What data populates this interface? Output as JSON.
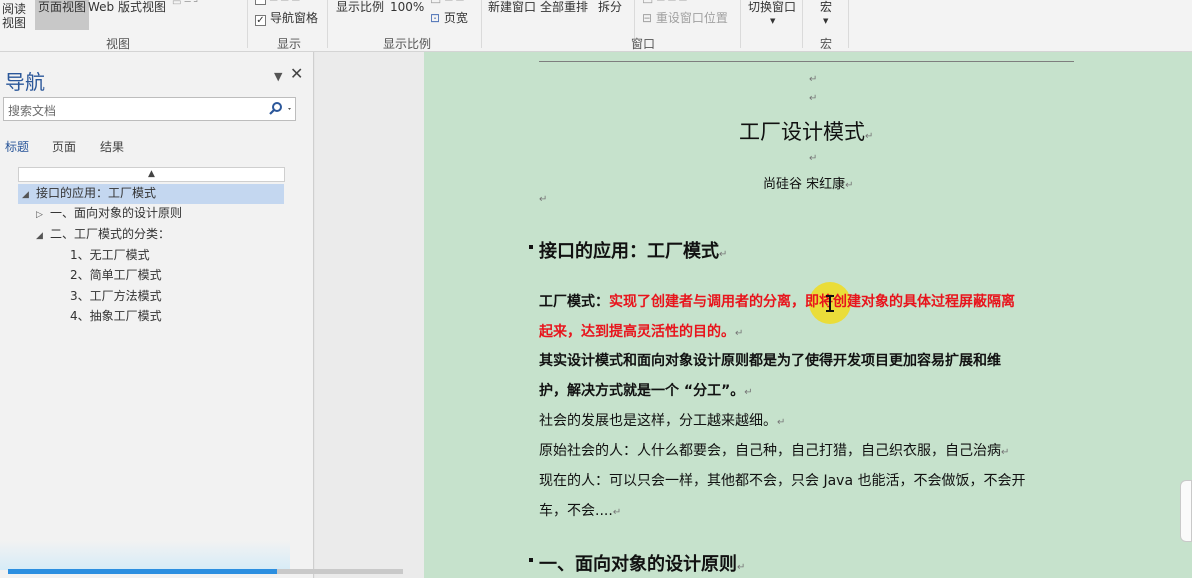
{
  "ribbon": {
    "view_group": {
      "read_view": "阅读\n视图",
      "page_view": "页面视图",
      "web_view": "Web 版式视图",
      "label": "视图"
    },
    "show_group": {
      "nav_pane": "导航窗格",
      "label": "显示"
    },
    "zoom_group": {
      "zoom": "显示比例",
      "hundred": "100%",
      "page_width": "页宽",
      "label": "显示比例"
    },
    "window_group": {
      "new_window": "新建窗口",
      "arrange_all": "全部重排",
      "split": "拆分",
      "reset_window": "重设窗口位置",
      "switch_window": "切换窗口",
      "label": "窗口"
    },
    "macro_group": {
      "macro": "宏",
      "label": "宏"
    }
  },
  "nav": {
    "title": "导航",
    "search_placeholder": "搜索文档",
    "tabs": [
      "标题",
      "页面",
      "结果"
    ],
    "headings": [
      {
        "text": "接口的应用：工厂模式",
        "level": 1,
        "expand": "◢",
        "selected": true
      },
      {
        "text": "一、面向对象的设计原则",
        "level": 2,
        "expand": "▷",
        "selected": false
      },
      {
        "text": "二、工厂模式的分类：",
        "level": 2,
        "expand": "◢",
        "selected": false
      },
      {
        "text": "1、无工厂模式",
        "level": 3,
        "expand": "",
        "selected": false
      },
      {
        "text": "2、简单工厂模式",
        "level": 3,
        "expand": "",
        "selected": false
      },
      {
        "text": "3、工厂方法模式",
        "level": 3,
        "expand": "",
        "selected": false
      },
      {
        "text": "4、抽象工厂模式",
        "level": 3,
        "expand": "",
        "selected": false
      }
    ]
  },
  "document": {
    "title": "工厂设计模式",
    "author": "尚硅谷 宋红康",
    "heading1": "接口的应用：工厂模式",
    "para1_label": "工厂模式：",
    "para1_red_a": "实现了创建者与调用者的分离，即将创建对象的具体过程屏蔽隔离",
    "para1_red_b": "起来，达到提高灵活性的目的。",
    "para2_a": "其实设计模式和面向对象设计原则都是为了使得开发项目更加容易扩展和维",
    "para2_b": "护，解决方式就是一个 “分工”。",
    "para3": "社会的发展也是这样，分工越来越细。",
    "para4": "原始社会的人：人什么都要会，自己种，自己打猎，自己织衣服，自己治病",
    "para5_a": "现在的人：可以只会一样，其他都不会，只会 Java 也能活，不会做饭，不会开",
    "para5_b": "车，不会....",
    "heading2": "一、面向对象的设计原则",
    "para_mark": "↵"
  },
  "player": {
    "progress": 0.68
  }
}
